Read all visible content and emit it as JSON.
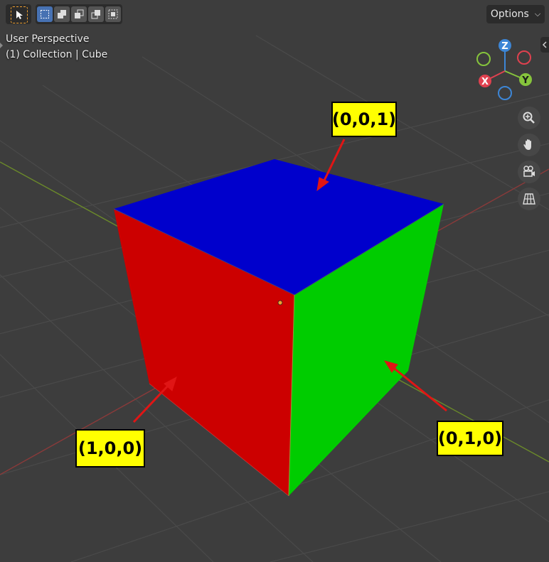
{
  "viewport": {
    "background": "#3d3d3d",
    "grid_color": "#4a4a4a",
    "axis_x_color": "#8a3a3a",
    "axis_y_color": "#6b8a2a"
  },
  "toolbar": {
    "select_tool_icon": "cursor-select-icon",
    "modes": [
      {
        "icon": "select-box-new-icon",
        "active": true
      },
      {
        "icon": "select-box-extend-icon",
        "active": false
      },
      {
        "icon": "select-box-subtract-icon",
        "active": false
      },
      {
        "icon": "select-box-invert-icon",
        "active": false
      },
      {
        "icon": "select-box-intersect-icon",
        "active": false
      }
    ],
    "options_label": "Options"
  },
  "overlay": {
    "view_name": "User Perspective",
    "collection_info": "(1) Collection | Cube"
  },
  "gizmo": {
    "z_label": "Z",
    "y_label": "Y",
    "x_label": "X",
    "x_color": "#e0414f",
    "y_color": "#86c43c",
    "z_color": "#3d86d6"
  },
  "nav_buttons": [
    {
      "icon": "zoom-icon"
    },
    {
      "icon": "hand-pan-icon"
    },
    {
      "icon": "camera-icon"
    },
    {
      "icon": "grid-perspective-icon"
    }
  ],
  "cube": {
    "top_color": "#0000cc",
    "left_color": "#cc0000",
    "right_color": "#00cc00"
  },
  "annotations": {
    "top_label": "(0,0,1)",
    "left_label": "(1,0,0)",
    "right_label": "(0,1,0)",
    "arrow_color": "#e01515"
  }
}
